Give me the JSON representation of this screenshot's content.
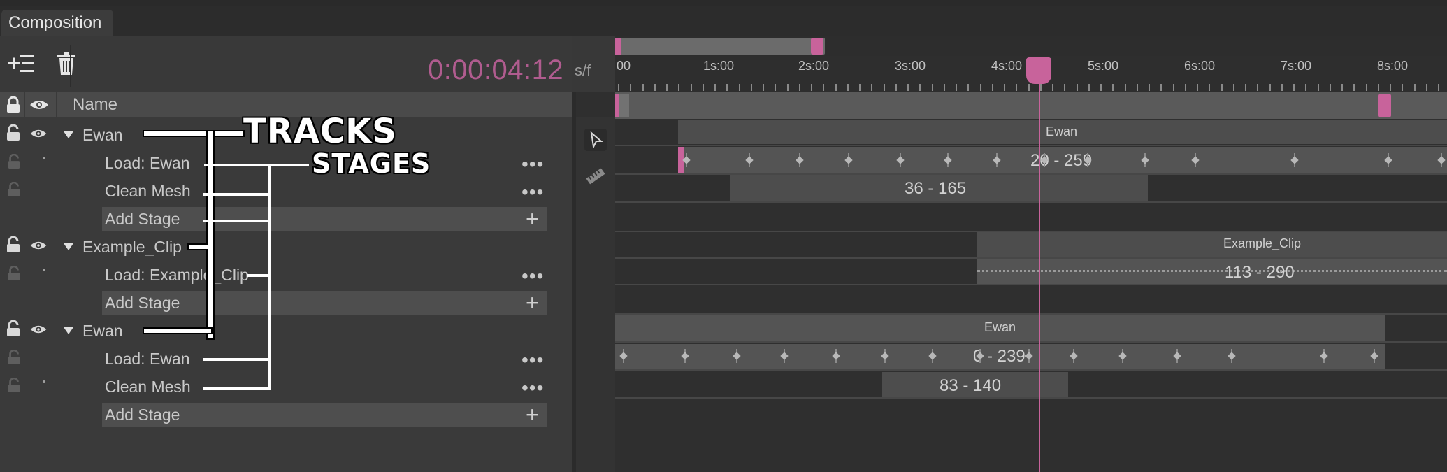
{
  "tab": {
    "label": "Composition"
  },
  "toolbar": {
    "add_track_icon": "add-list-icon",
    "delete_icon": "trash-icon",
    "timecode": "0:00:04:12",
    "timecode_unit": "s/f"
  },
  "header": {
    "name_column": "Name"
  },
  "tracks": [
    {
      "label": "Ewan",
      "stages": [
        "Load: Ewan",
        "Clean Mesh"
      ],
      "add_stage": "Add Stage"
    },
    {
      "label": "Example_Clip",
      "stages": [
        "Load: Example_Clip"
      ],
      "add_stage": "Add Stage"
    },
    {
      "label": "Ewan",
      "stages": [
        "Load: Ewan",
        "Clean Mesh"
      ],
      "add_stage": "Add Stage"
    }
  ],
  "more_label": "•••",
  "plus_label": "+",
  "ruler": {
    "labels": [
      "00",
      "1s:00",
      "2s:00",
      "3s:00",
      "4s:00",
      "5s:00",
      "6s:00",
      "7s:00",
      "8s:00"
    ]
  },
  "timeline": {
    "track1_clip": "Ewan",
    "track1_stage1_range": "20 - 259",
    "track1_stage2_range": "36 - 165",
    "track2_clip": "Example_Clip",
    "track2_stage1_range": "113 - 290",
    "track3_clip": "Ewan",
    "track3_stage1_range": "0 - 239",
    "track3_stage2_range": "83 - 140"
  },
  "annotations": {
    "tracks": "TRACKS",
    "stages": "STAGES"
  },
  "colors": {
    "accent": "#c8639b",
    "background": "#383838"
  }
}
